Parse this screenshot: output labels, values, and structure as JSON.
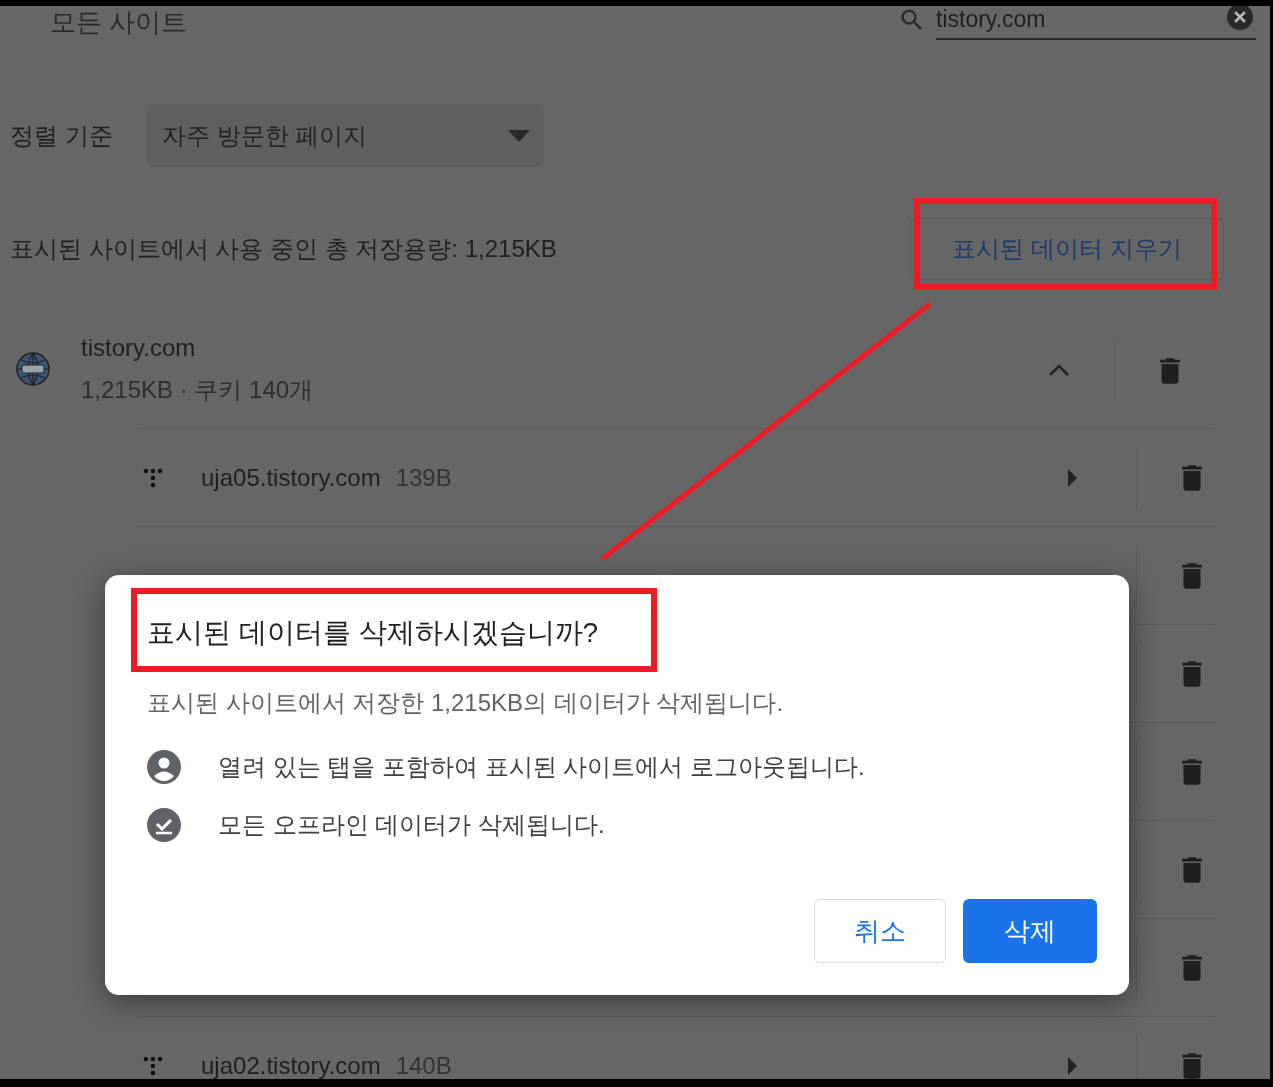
{
  "header": {
    "title": "모든 사이트"
  },
  "search": {
    "value": "tistory.com"
  },
  "sort": {
    "label": "정렬 기준",
    "value": "자주 방문한 페이지"
  },
  "storage_summary": "표시된 사이트에서 사용 중인 총 저장용량: 1,215KB",
  "clear_button": "표시된 데이터 지우기",
  "site": {
    "name": "tistory.com",
    "details": "1,215KB · 쿠키 140개",
    "expanded": true,
    "children": [
      {
        "kind": "visible",
        "name": "uja05.tistory.com",
        "size": "139B"
      },
      {
        "kind": "covered"
      },
      {
        "kind": "covered"
      },
      {
        "kind": "covered"
      },
      {
        "kind": "covered"
      },
      {
        "kind": "covered"
      },
      {
        "kind": "visible",
        "name": "uja02.tistory.com",
        "size": "140B"
      }
    ]
  },
  "dialog": {
    "title": "표시된 데이터를 삭제하시겠습니까?",
    "message": "표시된 사이트에서 저장한 1,215KB의 데이터가 삭제됩니다.",
    "items": [
      {
        "kind": "account",
        "text": "열려 있는 탭을 포함하여 표시된 사이트에서 로그아웃됩니다."
      },
      {
        "kind": "offline",
        "text": "모든 오프라인 데이터가 삭제됩니다."
      }
    ],
    "buttons": [
      {
        "kind": "secondary",
        "label": "취소"
      },
      {
        "kind": "primary",
        "label": "삭제"
      }
    ]
  }
}
